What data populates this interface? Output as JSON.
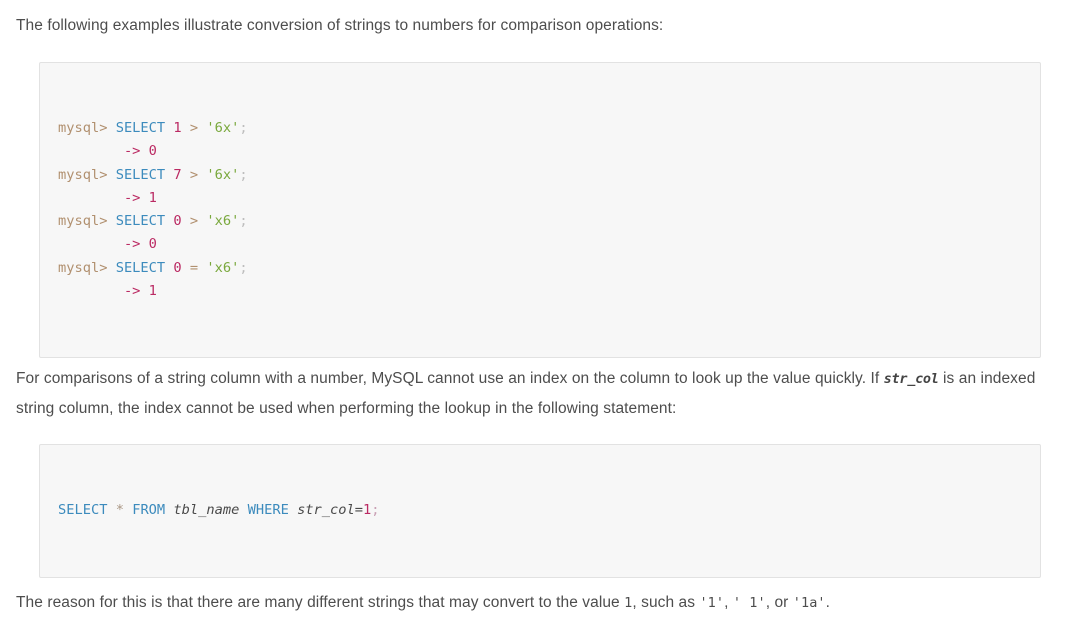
{
  "document": {
    "paragraph_1": "The following examples illustrate conversion of strings to numbers for comparison operations:",
    "paragraph_2": {
      "part_1": "For comparisons of a string column with a number, MySQL cannot use an index on the column to look up the value quickly. If ",
      "code_str_col": "str_col",
      "part_2": " is an indexed string column, the index cannot be used when performing the lookup in the following statement:"
    },
    "paragraph_3": {
      "part_1": "The reason for this is that there are many different strings that may convert to the value ",
      "code_1": "1",
      "part_2": ", such as ",
      "code_2": "'1'",
      "part_3": ", ",
      "code_3": "' 1'",
      "part_4": ", or ",
      "code_4": "'1a'",
      "part_5": "."
    }
  },
  "code_block_1": {
    "lines": [
      {
        "prompt": "mysql>",
        "keyword": "SELECT",
        "number": "1",
        "operator": ">",
        "string": "'6x'",
        "semicolon": ";"
      },
      {
        "arrow": "->",
        "result": "0"
      },
      {
        "prompt": "mysql>",
        "keyword": "SELECT",
        "number": "7",
        "operator": ">",
        "string": "'6x'",
        "semicolon": ";"
      },
      {
        "arrow": "->",
        "result": "1"
      },
      {
        "prompt": "mysql>",
        "keyword": "SELECT",
        "number": "0",
        "operator": ">",
        "string": "'x6'",
        "semicolon": ";"
      },
      {
        "arrow": "->",
        "result": "0"
      },
      {
        "prompt": "mysql>",
        "keyword": "SELECT",
        "number": "0",
        "operator": "=",
        "string": "'x6'",
        "semicolon": ";"
      },
      {
        "arrow": "->",
        "result": "1"
      }
    ],
    "raw": "mysql> SELECT 1 > '6x';\n        -> 0\nmysql> SELECT 7 > '6x';\n        -> 1\nmysql> SELECT 0 > 'x6';\n        -> 0\nmysql> SELECT 0 = 'x6';\n        -> 1"
  },
  "code_block_2": {
    "tokens": {
      "select": "SELECT",
      "star": "*",
      "from": "FROM",
      "table": "tbl_name",
      "where": "WHERE",
      "column": "str_col",
      "equals": "=",
      "value": "1",
      "semicolon": ";"
    },
    "raw": "SELECT * FROM tbl_name WHERE str_col=1;"
  },
  "theme": {
    "page_background": "#ffffff",
    "text_color": "#4d4d4d",
    "code_background": "#f7f7f7",
    "code_border": "#e2e2e2",
    "keyword_color": "#3c8bbd",
    "number_color": "#bb2a63",
    "string_color": "#79a83c",
    "prompt_color": "#b1906f",
    "arrow_color": "#bb2a63"
  }
}
